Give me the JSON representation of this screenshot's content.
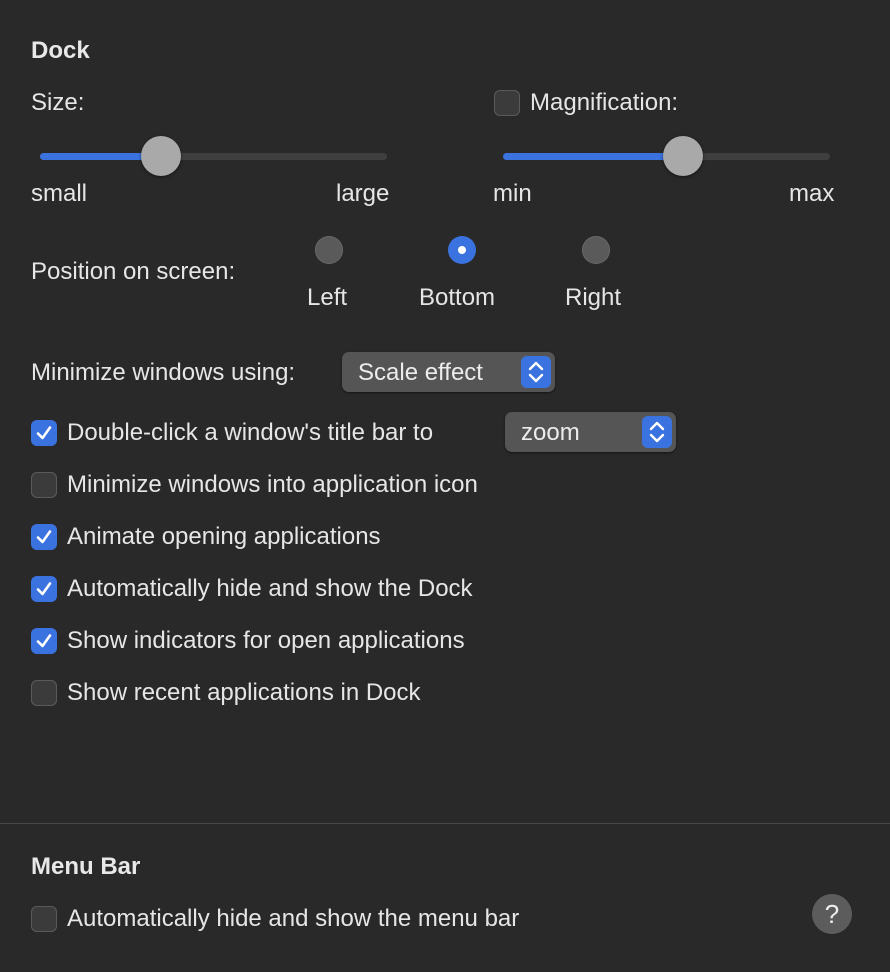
{
  "dock": {
    "title": "Dock",
    "size": {
      "label": "Size:",
      "min_label": "small",
      "max_label": "large",
      "value_fraction": 0.35
    },
    "magnification": {
      "label": "Magnification:",
      "checked": false,
      "min_label": "min",
      "max_label": "max",
      "value_fraction": 0.55
    },
    "position": {
      "label": "Position on screen:",
      "options": [
        {
          "label": "Left",
          "selected": false
        },
        {
          "label": "Bottom",
          "selected": true
        },
        {
          "label": "Right",
          "selected": false
        }
      ]
    },
    "minimize_using": {
      "label": "Minimize windows using:",
      "value": "Scale effect"
    },
    "double_click": {
      "label": "Double-click a window's title bar to",
      "checked": true,
      "value": "zoom"
    },
    "checkboxes": [
      {
        "label": "Minimize windows into application icon",
        "checked": false
      },
      {
        "label": "Animate opening applications",
        "checked": true
      },
      {
        "label": "Automatically hide and show the Dock",
        "checked": true
      },
      {
        "label": "Show indicators for open applications",
        "checked": true
      },
      {
        "label": "Show recent applications in Dock",
        "checked": false
      }
    ]
  },
  "menu_bar": {
    "title": "Menu Bar",
    "autohide": {
      "label": "Automatically hide and show the menu bar",
      "checked": false
    }
  },
  "help": {
    "glyph": "?"
  },
  "colors": {
    "accent": "#3a72e0",
    "background": "#292929"
  }
}
